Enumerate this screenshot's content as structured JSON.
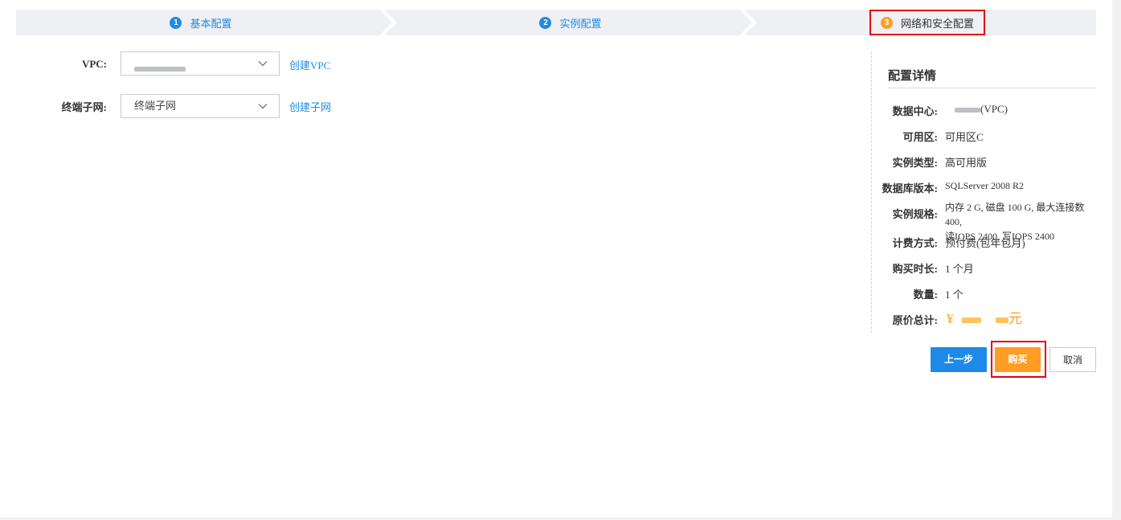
{
  "steps": [
    {
      "num": "1",
      "label": "基本配置",
      "state": "done"
    },
    {
      "num": "2",
      "label": "实例配置",
      "state": "done"
    },
    {
      "num": "3",
      "label": "网络和安全配置",
      "state": "active"
    }
  ],
  "form": {
    "vpc_label": "VPC:",
    "vpc_value": "",
    "create_vpc": "创建VPC",
    "subnet_label": "终端子网:",
    "subnet_value": "终端子网",
    "create_subnet": "创建子网"
  },
  "detail": {
    "title": "配置详情",
    "datacenter_label": "数据中心:",
    "datacenter_suffix": "(VPC)",
    "zone_label": "可用区:",
    "zone_value": "可用区C",
    "type_label": "实例类型:",
    "type_value": "高可用版",
    "dbver_label": "数据库版本:",
    "dbver_value": "SQLServer 2008 R2",
    "spec_label": "实例规格:",
    "spec_line1": "内存 2 G, 磁盘 100 G, 最大连接数 400,",
    "spec_line2": "读IOPS 2400, 写IOPS 2400",
    "billing_label": "计费方式:",
    "billing_value": "预付费(包年包月)",
    "duration_label": "购买时长:",
    "duration_value": "1 个月",
    "qty_label": "数量:",
    "qty_value": "1 个",
    "total_label": "原价总计:",
    "total_currency": "¥",
    "total_unit": "元"
  },
  "buttons": {
    "prev": "上一步",
    "buy": "购买",
    "cancel": "取消"
  },
  "colors": {
    "primary": "#1e8ae7",
    "accent": "#ff9d24",
    "highlight": "#e3000f"
  }
}
